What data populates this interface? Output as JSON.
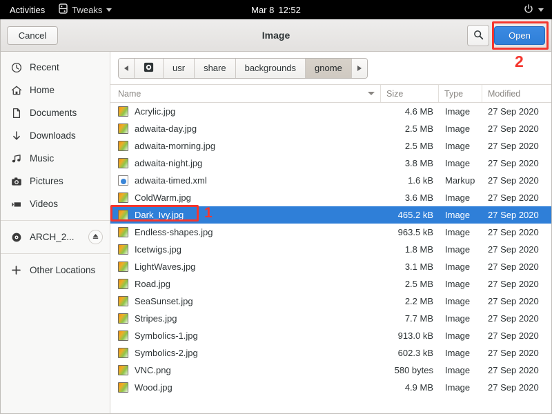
{
  "topbar": {
    "activities": "Activities",
    "app_name": "Tweaks",
    "app_icon": "tweaks-icon",
    "date": "Mar 8",
    "time": "12:52",
    "power_icon": "power-icon",
    "menu_caret": "chevron-down-icon"
  },
  "headerbar": {
    "cancel_label": "Cancel",
    "title": "Image",
    "search_icon": "search-icon",
    "open_label": "Open",
    "open_color": "#2f7fd8"
  },
  "sidebar": {
    "items": [
      {
        "label": "Recent",
        "icon": "clock-icon"
      },
      {
        "label": "Home",
        "icon": "home-icon"
      },
      {
        "label": "Documents",
        "icon": "document-icon"
      },
      {
        "label": "Downloads",
        "icon": "download-arrow-icon"
      },
      {
        "label": "Music",
        "icon": "music-note-icon"
      },
      {
        "label": "Pictures",
        "icon": "camera-icon"
      },
      {
        "label": "Videos",
        "icon": "video-icon"
      }
    ],
    "devices": [
      {
        "label": "ARCH_2...",
        "icon": "disc-icon",
        "eject_icon": "eject-icon"
      }
    ],
    "other_locations": {
      "label": "Other Locations",
      "icon": "plus-icon"
    }
  },
  "pathbar": {
    "back_icon": "chevron-left-icon",
    "forward_icon": "chevron-right-icon",
    "root_icon": "device-disc-icon",
    "segments": [
      {
        "label": "usr",
        "active": false
      },
      {
        "label": "share",
        "active": false
      },
      {
        "label": "backgrounds",
        "active": false
      },
      {
        "label": "gnome",
        "active": true
      }
    ]
  },
  "filelist": {
    "columns": {
      "name": "Name",
      "size": "Size",
      "type": "Type",
      "modified": "Modified"
    },
    "sort": {
      "column": "Name",
      "direction": "descending",
      "icon": "sort-caret-down-icon"
    },
    "rows": [
      {
        "name": "Acrylic.jpg",
        "size": "4.6 MB",
        "type": "Image",
        "modified": "27 Sep 2020",
        "icon": "image",
        "selected": false
      },
      {
        "name": "adwaita-day.jpg",
        "size": "2.5 MB",
        "type": "Image",
        "modified": "27 Sep 2020",
        "icon": "image",
        "selected": false
      },
      {
        "name": "adwaita-morning.jpg",
        "size": "2.5 MB",
        "type": "Image",
        "modified": "27 Sep 2020",
        "icon": "image",
        "selected": false
      },
      {
        "name": "adwaita-night.jpg",
        "size": "3.8 MB",
        "type": "Image",
        "modified": "27 Sep 2020",
        "icon": "image",
        "selected": false
      },
      {
        "name": "adwaita-timed.xml",
        "size": "1.6 kB",
        "type": "Markup",
        "modified": "27 Sep 2020",
        "icon": "markup",
        "selected": false
      },
      {
        "name": "ColdWarm.jpg",
        "size": "3.6 MB",
        "type": "Image",
        "modified": "27 Sep 2020",
        "icon": "image",
        "selected": false
      },
      {
        "name": "Dark_Ivy.jpg",
        "size": "465.2 kB",
        "type": "Image",
        "modified": "27 Sep 2020",
        "icon": "image",
        "selected": true
      },
      {
        "name": "Endless-shapes.jpg",
        "size": "963.5 kB",
        "type": "Image",
        "modified": "27 Sep 2020",
        "icon": "image",
        "selected": false
      },
      {
        "name": "Icetwigs.jpg",
        "size": "1.8 MB",
        "type": "Image",
        "modified": "27 Sep 2020",
        "icon": "image",
        "selected": false
      },
      {
        "name": "LightWaves.jpg",
        "size": "3.1 MB",
        "type": "Image",
        "modified": "27 Sep 2020",
        "icon": "image",
        "selected": false
      },
      {
        "name": "Road.jpg",
        "size": "2.5 MB",
        "type": "Image",
        "modified": "27 Sep 2020",
        "icon": "image",
        "selected": false
      },
      {
        "name": "SeaSunset.jpg",
        "size": "2.2 MB",
        "type": "Image",
        "modified": "27 Sep 2020",
        "icon": "image",
        "selected": false
      },
      {
        "name": "Stripes.jpg",
        "size": "7.7 MB",
        "type": "Image",
        "modified": "27 Sep 2020",
        "icon": "image",
        "selected": false
      },
      {
        "name": "Symbolics-1.jpg",
        "size": "913.0 kB",
        "type": "Image",
        "modified": "27 Sep 2020",
        "icon": "image",
        "selected": false
      },
      {
        "name": "Symbolics-2.jpg",
        "size": "602.3 kB",
        "type": "Image",
        "modified": "27 Sep 2020",
        "icon": "image",
        "selected": false
      },
      {
        "name": "VNC.png",
        "size": "580 bytes",
        "type": "Image",
        "modified": "27 Sep 2020",
        "icon": "image",
        "selected": false
      },
      {
        "name": "Wood.jpg",
        "size": "4.9 MB",
        "type": "Image",
        "modified": "27 Sep 2020",
        "icon": "image",
        "selected": false
      }
    ]
  },
  "annotations": {
    "color": "#f4362e",
    "markers": [
      {
        "label": "1",
        "target": "Dark_Ivy.jpg"
      },
      {
        "label": "2",
        "target": "Open"
      }
    ]
  }
}
